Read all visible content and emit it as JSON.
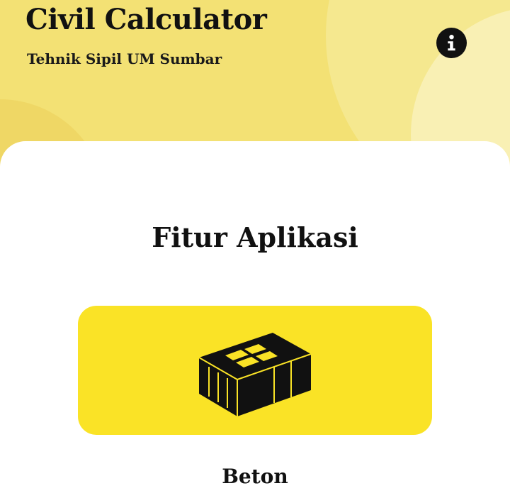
{
  "header": {
    "title": "Civil Calculator",
    "subtitle": "Tehnik Sipil UM Sumbar",
    "info_icon": "info-icon"
  },
  "main": {
    "section_title": "Fitur Aplikasi",
    "features": [
      {
        "label": "Beton",
        "icon": "concrete-block-icon"
      }
    ]
  },
  "colors": {
    "header_background": "#f3e174",
    "card_background": "#fae326",
    "content_background": "#ffffff",
    "text": "#111111"
  }
}
